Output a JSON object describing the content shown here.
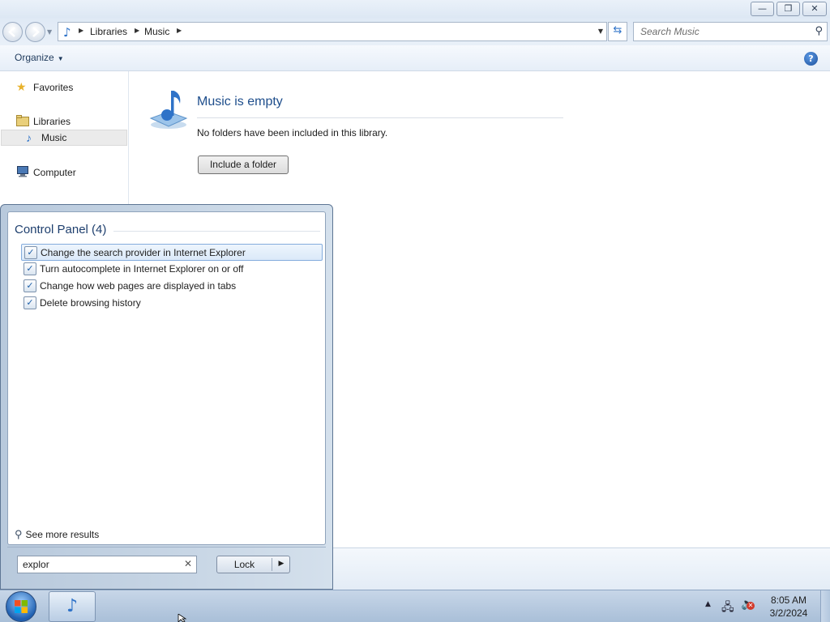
{
  "window": {
    "caption_buttons": {
      "minimize": "—",
      "maximize": "❐",
      "close": "✕"
    },
    "address": {
      "icon": "music-library-icon",
      "crumbs": [
        "Libraries",
        "Music"
      ]
    },
    "search": {
      "placeholder": "Search Music"
    },
    "command_bar": {
      "organize_label": "Organize",
      "help_label": "?"
    }
  },
  "nav_pane": {
    "items": [
      {
        "label": "Favorites",
        "icon": "star-icon"
      },
      {
        "label": "Libraries",
        "icon": "libraries-icon"
      },
      {
        "label": "Music",
        "icon": "music-icon",
        "selected": true
      },
      {
        "label": "Computer",
        "icon": "computer-icon"
      }
    ]
  },
  "content": {
    "title": "Music is empty",
    "description": "No folders have been included in this library.",
    "include_button": "Include a folder"
  },
  "start_menu": {
    "group_title": "Control Panel (4)",
    "results": [
      {
        "label": "Change the search provider in Internet Explorer",
        "highlighted": true
      },
      {
        "label": "Turn autocomplete in Internet Explorer on or off"
      },
      {
        "label": "Change how web pages are displayed in tabs"
      },
      {
        "label": "Delete browsing history"
      }
    ],
    "see_more": "See more results",
    "search_value": "explor",
    "lock_label": "Lock"
  },
  "taskbar": {
    "time": "8:05 AM",
    "date": "3/2/2024"
  },
  "colors": {
    "accent": "#1e4e8c",
    "highlight_border": "#84acdd"
  }
}
